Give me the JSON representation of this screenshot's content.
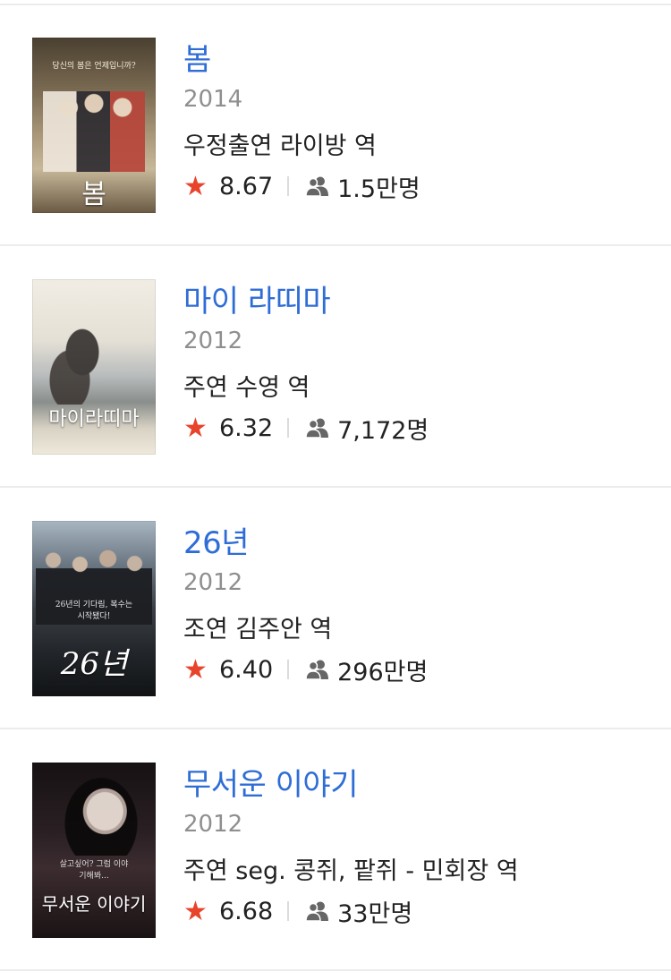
{
  "films": [
    {
      "title": "봄",
      "year": "2014",
      "role": "우정출연 라이방 역",
      "rating": "8.67",
      "audience": "1.5만명",
      "poster": {
        "title": "봄",
        "tagline": "당신의 봄은 언제입니까?",
        "colors": [
          "#7a6a52",
          "#c8b89a",
          "#3d3326"
        ]
      }
    },
    {
      "title": "마이 라띠마",
      "year": "2012",
      "role": "주연 수영 역",
      "rating": "6.32",
      "audience": "7,172명",
      "poster": {
        "title": "마이라띠마",
        "tagline": "",
        "colors": [
          "#e9e4d8",
          "#9aa0a0",
          "#4a4a48"
        ]
      }
    },
    {
      "title": "26년",
      "year": "2012",
      "role": "조연 김주안 역",
      "rating": "6.40",
      "audience": "296만명",
      "poster": {
        "title": "26년",
        "tagline": "26년의 기다림, 복수는 시작됐다!",
        "colors": [
          "#8a9aa8",
          "#3a3f45",
          "#15181b"
        ]
      }
    },
    {
      "title": "무서운 이야기",
      "year": "2012",
      "role": "주연 seg. 콩쥐, 팥쥐 - 민회장 역",
      "rating": "6.68",
      "audience": "33만명",
      "poster": {
        "title": "무서운 이야기",
        "tagline": "살고싶어? 그럼 이야기해봐...",
        "colors": [
          "#1a1414",
          "#3c2c30",
          "#6a4a50"
        ]
      }
    }
  ],
  "colors": {
    "title": "#2f6dd6",
    "year": "#8f8f8f",
    "star": "#e8432b",
    "text": "#222222",
    "divider": "#ececec"
  }
}
